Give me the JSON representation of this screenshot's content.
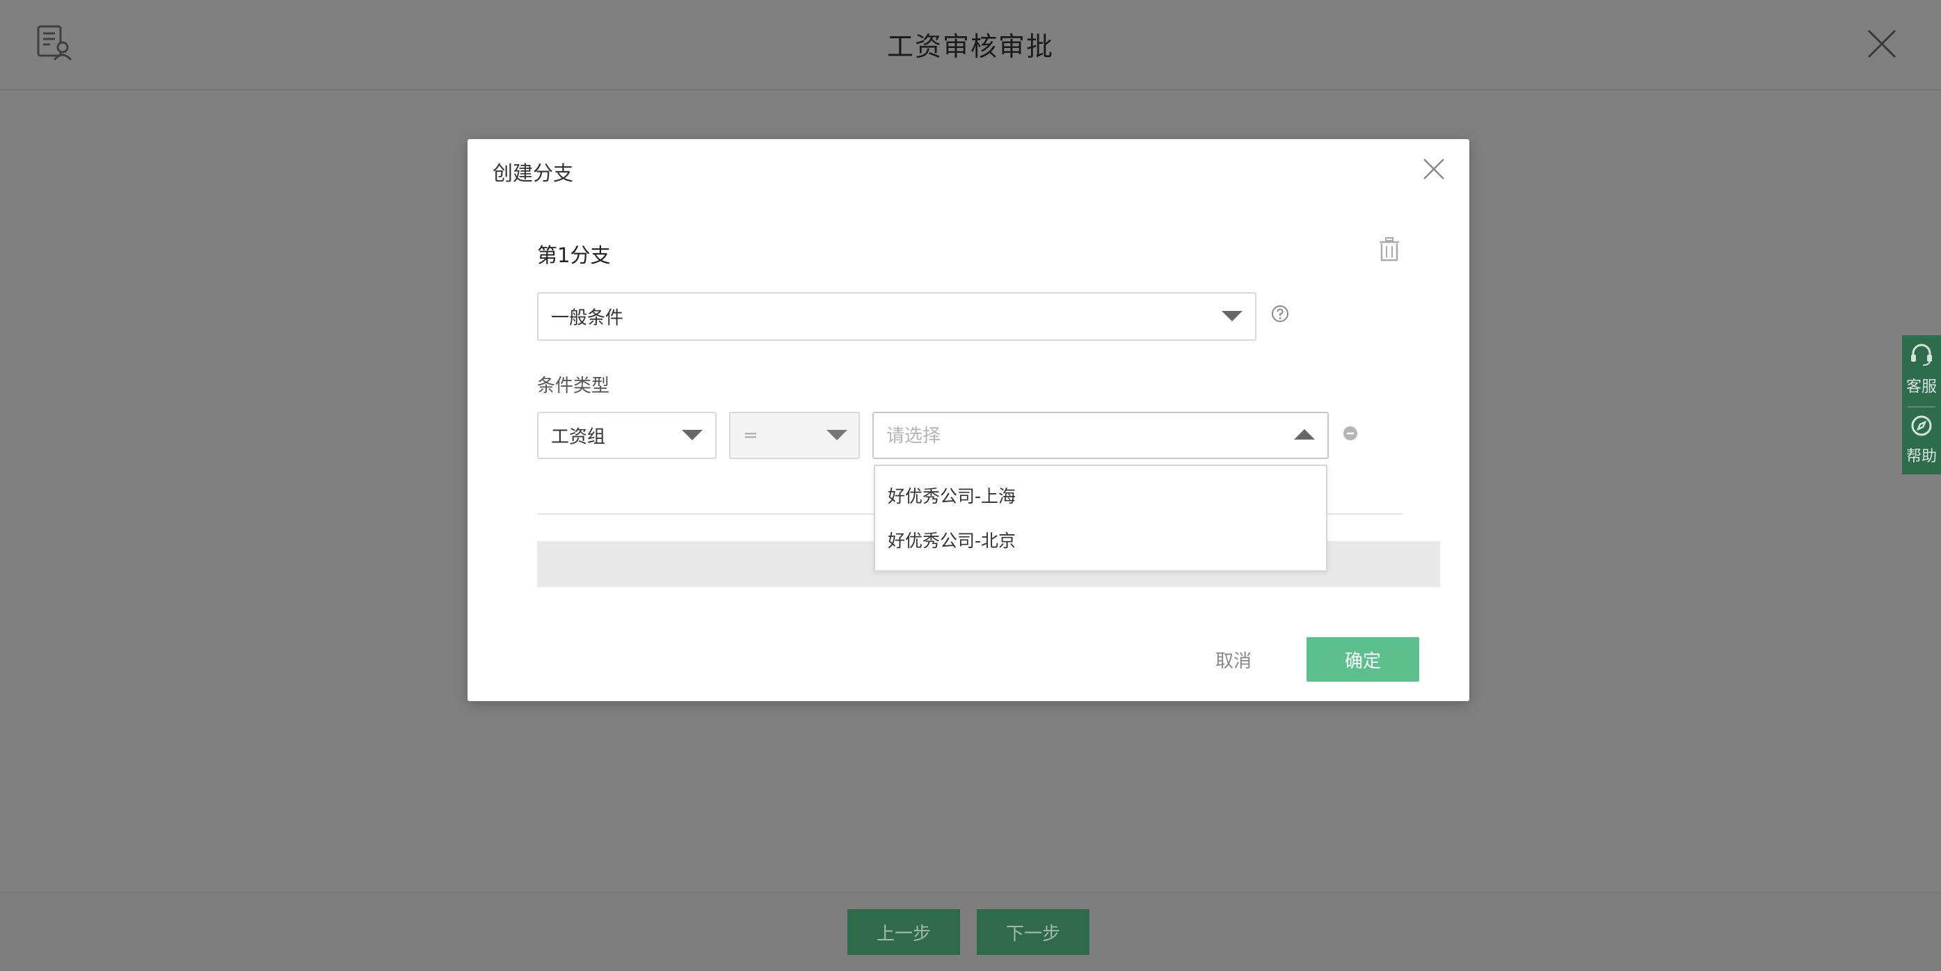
{
  "page": {
    "title": "工资审核审批",
    "prev_label": "上一步",
    "next_label": "下一步"
  },
  "side_rail": {
    "service_label": "客服",
    "help_label": "帮助"
  },
  "modal": {
    "title": "创建分支",
    "branch_title": "第1分支",
    "condition_type_value": "一般条件",
    "condition_label": "条件类型",
    "field_value": "工资组",
    "operator_value": "=",
    "value_placeholder": "请选择",
    "options": [
      "好优秀公司-上海",
      "好优秀公司-北京"
    ],
    "cancel_label": "取消",
    "ok_label": "确定"
  },
  "colors": {
    "overlay": "#808080",
    "primary": "#5cc08e",
    "primary_dimmed": "#2f6b4b"
  }
}
